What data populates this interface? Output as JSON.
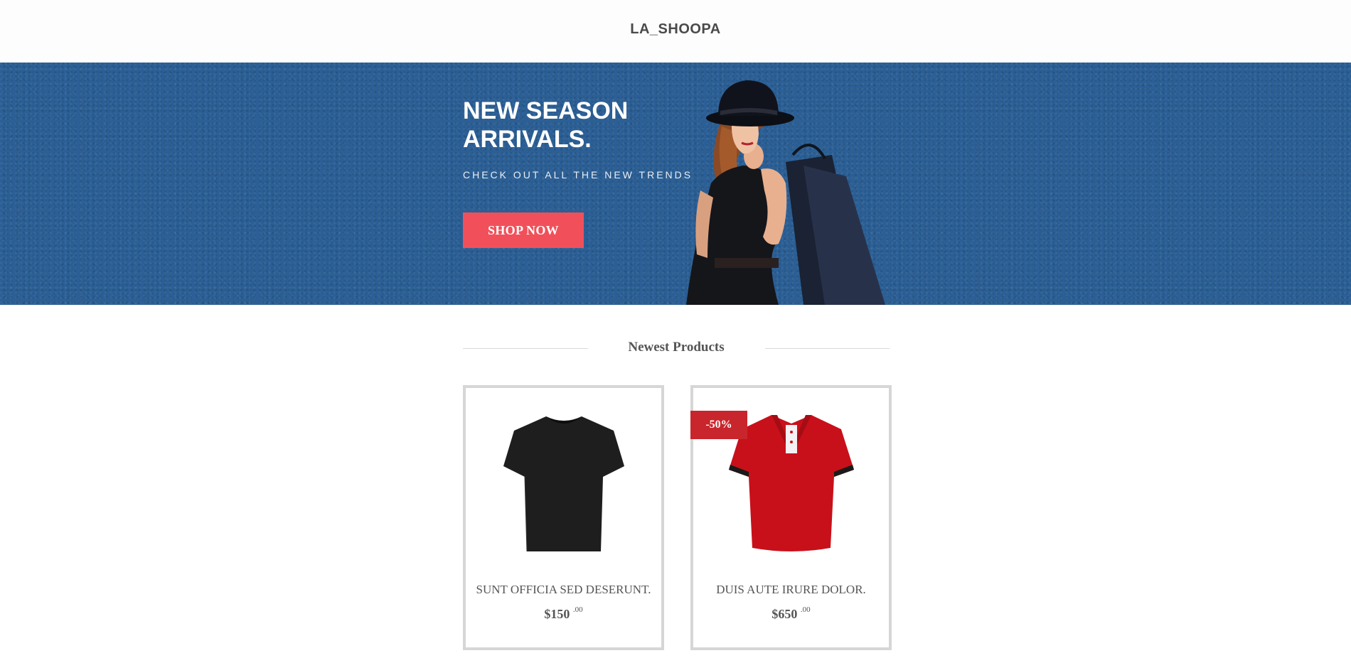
{
  "header": {
    "logo": "LA_SHOOPA"
  },
  "hero": {
    "title": "NEW SEASON ARRIVALS.",
    "subtitle": "CHECK OUT ALL THE NEW TRENDS",
    "button_label": "SHOP NOW"
  },
  "products_section": {
    "title": "Newest Products",
    "items": [
      {
        "name": "SUNT OFFICIA SED DESERUNT.",
        "price": "$150",
        "cents": ".00",
        "badge": "",
        "image": "black-tshirt"
      },
      {
        "name": "DUIS AUTE IRURE DOLOR.",
        "price": "$650",
        "cents": ".00",
        "badge": "-50%",
        "image": "red-polo-shirt"
      }
    ]
  },
  "colors": {
    "hero_bg": "#2b5f95",
    "button": "#f1505a",
    "badge": "#c8262c",
    "card_border": "#d6d6d6"
  }
}
